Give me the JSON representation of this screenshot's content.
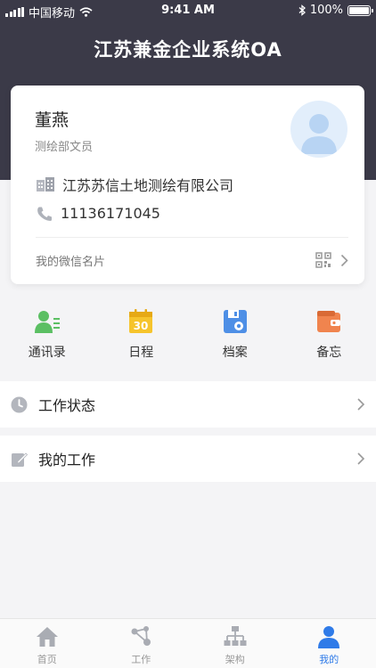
{
  "status_bar": {
    "carrier": "中国移动",
    "time": "9:41 AM",
    "battery": "100%"
  },
  "app": {
    "title": "江苏兼金企业系统OA"
  },
  "profile": {
    "name": "董燕",
    "department": "测绘部文员",
    "company": "江苏苏信土地测绘有限公司",
    "phone": "11136171045",
    "wechat_card_label": "我的微信名片"
  },
  "quick_actions": [
    {
      "label": "通讯录",
      "icon": "contacts-icon"
    },
    {
      "label": "日程",
      "icon": "calendar-icon",
      "badge": "30"
    },
    {
      "label": "档案",
      "icon": "archive-icon"
    },
    {
      "label": "备忘",
      "icon": "memo-wallet-icon"
    }
  ],
  "menu": [
    {
      "label": "工作状态",
      "icon": "clock-icon"
    },
    {
      "label": "我的工作",
      "icon": "edit-icon"
    }
  ],
  "tabbar": [
    {
      "label": "首页",
      "icon": "home-icon",
      "active": false
    },
    {
      "label": "工作",
      "icon": "work-network-icon",
      "active": false
    },
    {
      "label": "架构",
      "icon": "org-structure-icon",
      "active": false
    },
    {
      "label": "我的",
      "icon": "person-icon",
      "active": true
    }
  ],
  "colors": {
    "header_bg": "#3b3a48",
    "accent_blue": "#2f7be8",
    "contacts_green": "#5bbf63",
    "calendar_yellow": "#f6c42c",
    "archive_blue": "#4e8fe6",
    "memo_orange": "#f0844e"
  }
}
